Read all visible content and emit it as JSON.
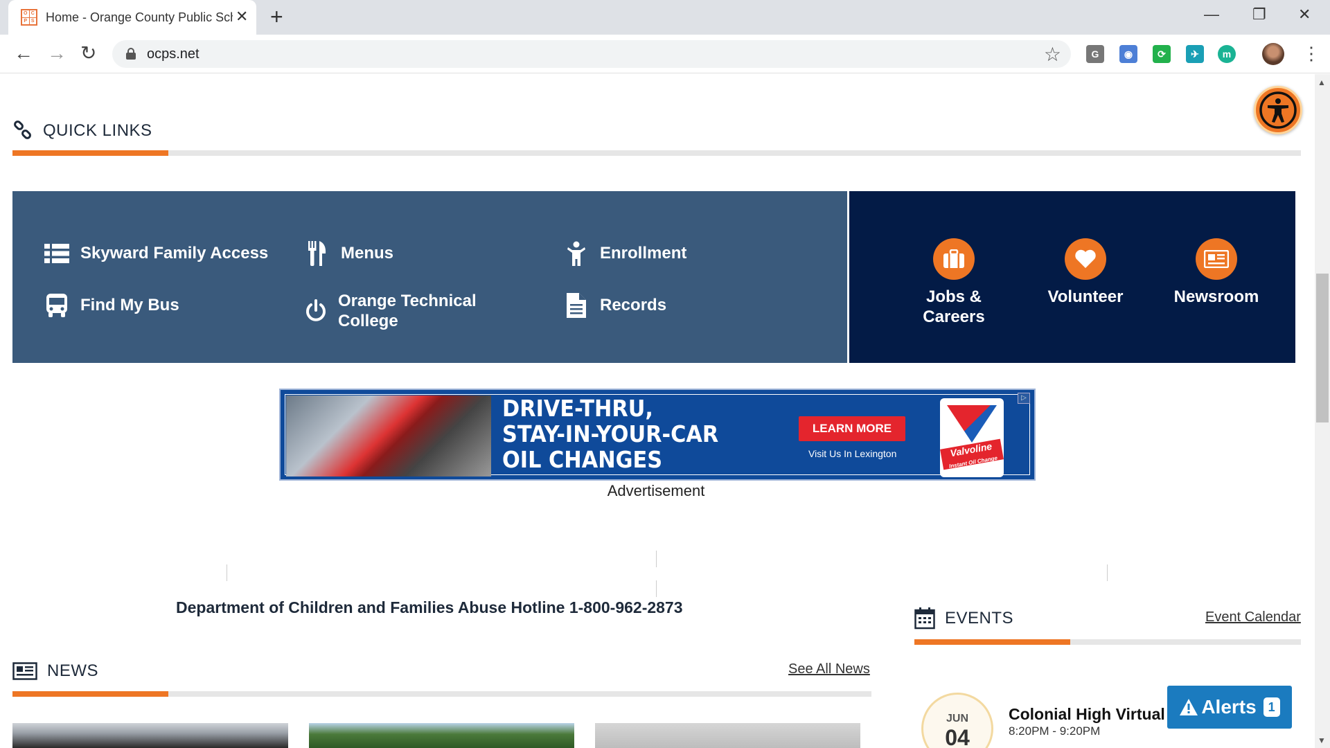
{
  "browser": {
    "tab_title": "Home - Orange County Public Schools",
    "favicon_letters": [
      "O",
      "C",
      "P",
      "S"
    ],
    "url": "ocps.net",
    "extensions": [
      {
        "name": "g-extension-icon",
        "label": "G",
        "color": "#777777"
      },
      {
        "name": "camera-extension-icon",
        "label": "◉",
        "color": "#4d7fd6"
      },
      {
        "name": "sync-extension-icon",
        "label": "⟳",
        "color": "#22b14c"
      },
      {
        "name": "badge-extension-icon",
        "label": "✈",
        "color": "#1a9fb5"
      },
      {
        "name": "m-extension-icon",
        "label": "m",
        "color": "#1ab394"
      }
    ]
  },
  "quick_links": {
    "heading": "QUICK LINKS",
    "items": [
      {
        "label": "Skyward Family Access",
        "icon": "list-icon"
      },
      {
        "label": "Menus",
        "icon": "utensils-icon"
      },
      {
        "label": "Enrollment",
        "icon": "child-icon"
      },
      {
        "label": "Find My Bus",
        "icon": "bus-icon"
      },
      {
        "label": "Orange Technical College",
        "icon": "power-icon"
      },
      {
        "label": "Records",
        "icon": "document-icon"
      }
    ],
    "featured": [
      {
        "label": "Jobs & Careers",
        "icon": "briefcase-icon"
      },
      {
        "label": "Volunteer",
        "icon": "heart-icon"
      },
      {
        "label": "Newsroom",
        "icon": "newspaper-icon"
      }
    ]
  },
  "ad": {
    "headline_lines": [
      "DRIVE-THRU,",
      "STAY-IN-YOUR-CAR",
      "OIL CHANGES"
    ],
    "cta": "LEARN MORE",
    "sub": "Visit Us In Lexington",
    "brand": "Valvoline",
    "brand_sub": "Instant Oil Change",
    "caption": "Advertisement"
  },
  "hotline": "Department of Children and Families Abuse Hotline 1-800-962-2873",
  "news": {
    "heading": "NEWS",
    "see_all": "See All News"
  },
  "events": {
    "heading": "EVENTS",
    "calendar_link": "Event Calendar",
    "items": [
      {
        "month": "JUN",
        "day": "04",
        "title": "Colonial High Virtual",
        "time": "8:20PM - 9:20PM"
      }
    ]
  },
  "alerts": {
    "label": "Alerts",
    "count": "1"
  },
  "colors": {
    "accent": "#ee7624",
    "quick_links_bg": "#3a5a7c",
    "featured_bg": "#031b46",
    "alerts_bg": "#1b7bbf"
  }
}
